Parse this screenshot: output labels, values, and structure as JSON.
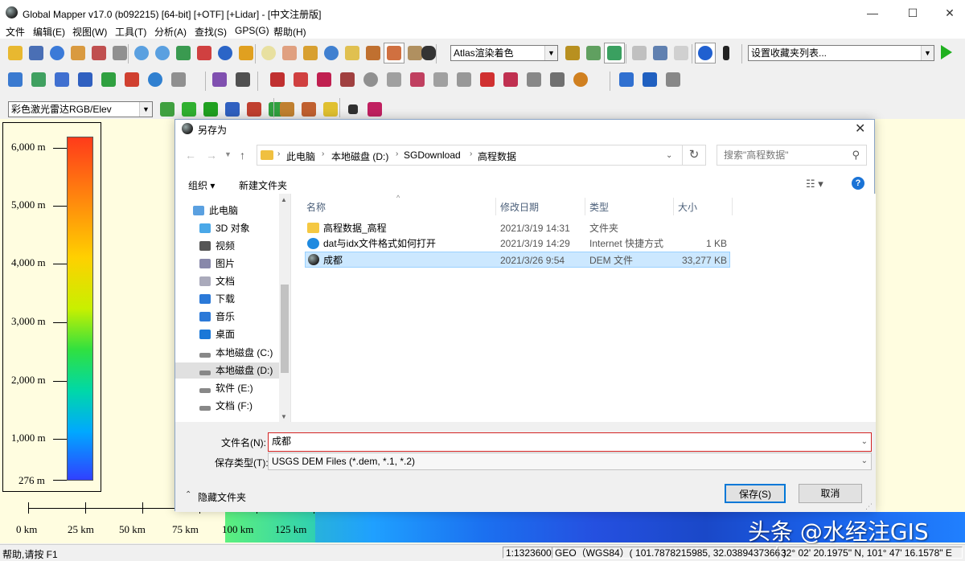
{
  "app": {
    "title": "Global Mapper v17.0 (b092215) [64-bit] [+OTF] [+Lidar] - [中文注册版]",
    "menu": [
      "文件",
      "编辑(E)",
      "视图(W)",
      "工具(T)",
      "分析(A)",
      "查找(S)",
      "GPS(G)",
      "帮助(H)"
    ]
  },
  "toolbar": {
    "shader_select": "Atlas渲染着色",
    "favorites_select": "设置收藏夹列表...",
    "lidar_color_select": "彩色激光雷达RGB/Elev"
  },
  "legend": {
    "labels": [
      "6,000 m",
      "5,000 m",
      "4,000 m",
      "3,000 m",
      "2,000 m",
      "1,000 m",
      "276 m"
    ]
  },
  "scalebar": {
    "labels": [
      "0 km",
      "25 km",
      "50 km",
      "75 km",
      "100 km",
      "125 km"
    ]
  },
  "status": {
    "help": "帮助,请按 F1",
    "scale": "1:1323600",
    "projection": "GEO（WGS84）( 101.7878215985, 32.0389437366 )",
    "dms": "32° 02' 20.1975\" N, 101° 47' 16.1578\" E"
  },
  "dialog": {
    "title": "另存为",
    "breadcrumb": [
      "此电脑",
      "本地磁盘 (D:)",
      "SGDownload",
      "高程数据"
    ],
    "search_placeholder": "搜索\"高程数据\"",
    "organize": "组织 ▾",
    "new_folder": "新建文件夹",
    "nav": [
      {
        "label": "此电脑",
        "icon": "computer-icon"
      },
      {
        "label": "3D 对象",
        "icon": "cube-icon"
      },
      {
        "label": "视频",
        "icon": "video-icon"
      },
      {
        "label": "图片",
        "icon": "pictures-icon"
      },
      {
        "label": "文档",
        "icon": "documents-icon"
      },
      {
        "label": "下载",
        "icon": "download-icon"
      },
      {
        "label": "音乐",
        "icon": "music-icon"
      },
      {
        "label": "桌面",
        "icon": "desktop-icon"
      },
      {
        "label": "本地磁盘 (C:)",
        "icon": "drive-icon"
      },
      {
        "label": "本地磁盘 (D:)",
        "icon": "drive-icon"
      },
      {
        "label": "软件 (E:)",
        "icon": "drive-icon"
      },
      {
        "label": "文档 (F:)",
        "icon": "drive-icon"
      }
    ],
    "columns": {
      "name": "名称",
      "modified": "修改日期",
      "type": "类型",
      "size": "大小"
    },
    "files": [
      {
        "name": "高程数据_高程",
        "modified": "2021/3/19 14:31",
        "type": "文件夹",
        "size": "",
        "icon": "folder-icon"
      },
      {
        "name": "dat与idx文件格式如何打开",
        "modified": "2021/3/19 14:29",
        "type": "Internet 快捷方式",
        "size": "1 KB",
        "icon": "internet-shortcut-icon"
      },
      {
        "name": "成都",
        "modified": "2021/3/26 9:54",
        "type": "DEM 文件",
        "size": "33,277 KB",
        "icon": "globe-icon"
      }
    ],
    "filename_label": "文件名(N):",
    "filename_value": "成都",
    "filetype_label": "保存类型(T):",
    "filetype_value": "USGS DEM Files (*.dem, *.1, *.2)",
    "hide_folders": "隐藏文件夹",
    "save": "保存(S)",
    "cancel": "取消"
  },
  "watermark": "头条 @水经注GIS"
}
